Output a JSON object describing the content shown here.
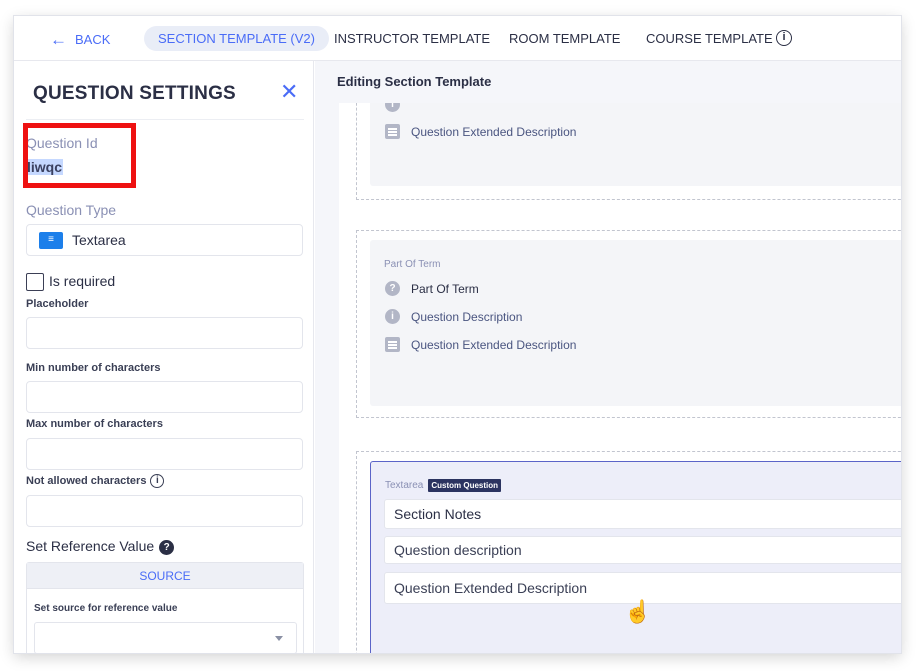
{
  "nav": {
    "back_label": "BACK",
    "tabs": [
      {
        "label": "SECTION TEMPLATE (V2)"
      },
      {
        "label": "INSTRUCTOR TEMPLATE"
      },
      {
        "label": "ROOM TEMPLATE"
      },
      {
        "label": "COURSE TEMPLATE"
      }
    ],
    "info_glyph": "i"
  },
  "settings": {
    "title": "QUESTION SETTINGS",
    "close_glyph": "✕",
    "question_id_label": "Question Id",
    "question_id_value": "liwqc",
    "question_type_label": "Question Type",
    "question_type_value": "Textarea",
    "is_required_label": "Is required",
    "placeholder_label": "Placeholder",
    "min_chars_label": "Min number of characters",
    "max_chars_label": "Max number of characters",
    "not_allowed_label": "Not allowed characters",
    "reference_label": "Set Reference Value",
    "source_tab": "SOURCE",
    "source_field_label": "Set source for reference value"
  },
  "editor": {
    "title": "Editing Section Template",
    "card1": {
      "extended_description": "Question Extended Description"
    },
    "card2": {
      "heading": "Part Of Term",
      "name": "Part Of Term",
      "description": "Question Description",
      "extended_description": "Question Extended Description"
    },
    "card3": {
      "type": "Textarea",
      "badge": "Custom Question",
      "title_value": "Section Notes",
      "description_value": "Question description",
      "extended_value": "Question Extended Description"
    }
  },
  "colors": {
    "accent": "#4a6cf7",
    "highlight_box": "#ee1111",
    "selected_border": "#5b64c8",
    "textarea_icon": "#1c7fea"
  }
}
